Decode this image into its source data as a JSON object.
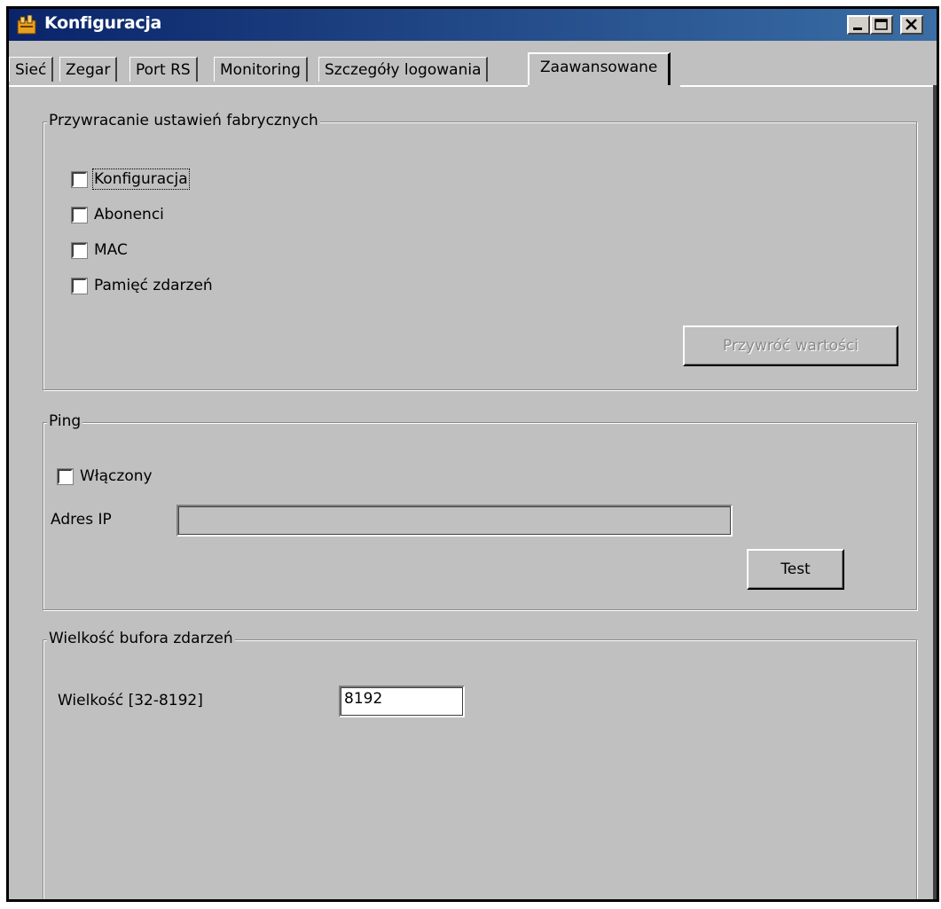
{
  "window": {
    "title": "Konfiguracja",
    "app_icon": "app-icon",
    "controls": [
      "minimize-icon",
      "maximize-icon",
      "close-icon"
    ]
  },
  "tabs": [
    {
      "label": "Sieć",
      "active": false
    },
    {
      "label": "Zegar",
      "active": false
    },
    {
      "label": "Port RS",
      "active": false
    },
    {
      "label": "Monitoring",
      "active": false
    },
    {
      "label": "Szczegóły logowania",
      "active": false
    },
    {
      "label": "Zaawansowane",
      "active": true
    }
  ],
  "factory_reset": {
    "legend": "Przywracanie ustawień fabrycznych",
    "options": [
      {
        "label": "Konfiguracja",
        "checked": false
      },
      {
        "label": "Abonenci",
        "checked": false
      },
      {
        "label": "MAC",
        "checked": false
      },
      {
        "label": "Pamięć zdarzeń",
        "checked": false
      }
    ],
    "restore_button": "Przywróć wartości"
  },
  "ping": {
    "legend": "Ping",
    "enabled_label": "Włączony",
    "enabled": false,
    "ip_label": "Adres IP",
    "ip_value": "",
    "test_button": "Test"
  },
  "buffer": {
    "legend": "Wielkość bufora zdarzeń",
    "size_label": "Wielkość [32-8192]",
    "size_value": "8192"
  },
  "colors": {
    "face": "#c0c0c0",
    "title_start": "#0a246a",
    "title_end": "#3a6ea5"
  }
}
